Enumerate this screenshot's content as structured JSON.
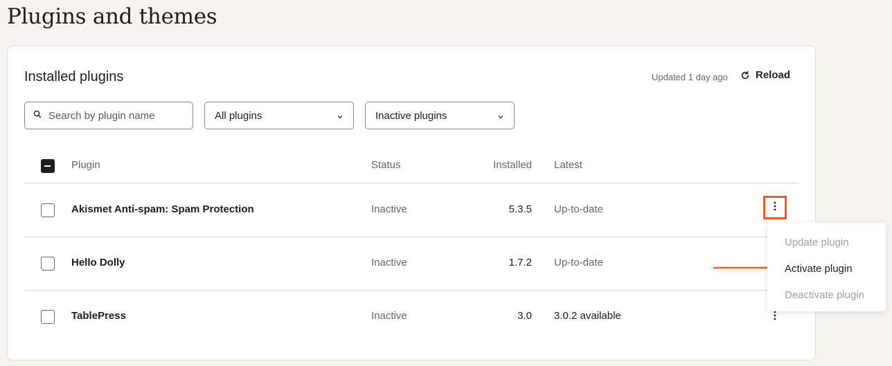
{
  "page": {
    "title": "Plugins and themes"
  },
  "card": {
    "title": "Installed plugins",
    "updated": "Updated 1 day ago",
    "reload_label": "Reload"
  },
  "filters": {
    "search_placeholder": "Search by plugin name",
    "type_filter": "All plugins",
    "status_filter": "Inactive plugins"
  },
  "table": {
    "headers": {
      "plugin": "Plugin",
      "status": "Status",
      "installed": "Installed",
      "latest": "Latest"
    },
    "rows": [
      {
        "name": "Akismet Anti-spam: Spam Protection",
        "status": "Inactive",
        "installed": "5.3.5",
        "latest": "Up-to-date"
      },
      {
        "name": "Hello Dolly",
        "status": "Inactive",
        "installed": "1.7.2",
        "latest": "Up-to-date"
      },
      {
        "name": "TablePress",
        "status": "Inactive",
        "installed": "3.0",
        "latest": "3.0.2 available"
      }
    ]
  },
  "menu": {
    "items": [
      {
        "label": "Update plugin",
        "enabled": false
      },
      {
        "label": "Activate plugin",
        "enabled": true
      },
      {
        "label": "Deactivate plugin",
        "enabled": false
      }
    ]
  },
  "colors": {
    "accent": "#ef5a2a",
    "background": "#f7f3ef",
    "muted_text": "#6d6560"
  }
}
